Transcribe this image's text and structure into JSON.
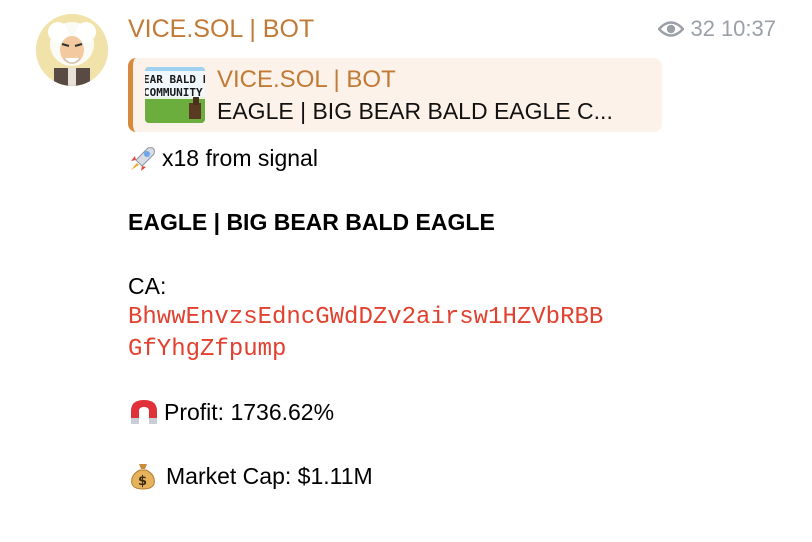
{
  "message": {
    "sender_name": "VICE.SOL | BOT",
    "views": "32",
    "time": "10:37",
    "reply": {
      "title": "VICE.SOL | BOT",
      "text": "EAGLE | BIG BEAR BALD EAGLE  C...",
      "thumb_text_line1": "EAR BALD E",
      "thumb_text_line2": "COMMUNITY"
    },
    "signal_text": "x18 from signal",
    "token_name": "EAGLE | BIG BEAR BALD EAGLE",
    "ca_label": "CA:",
    "ca_line1": "BhwwEnvzsEdncGWdDZv2airsw1HZVbRBB",
    "ca_line2": "GfYhgZfpump",
    "profit_text": "Profit: 1736.62%",
    "market_cap_text": "Market Cap: $1.11M"
  },
  "icons": {
    "views": "eye-icon",
    "signal": "rocket-emoji",
    "profit": "magnet-emoji",
    "market_cap": "money-bag-emoji"
  },
  "colors": {
    "sender": "#c07a35",
    "reply_bar": "#d88a3c",
    "reply_bg": "#fdf2e9",
    "contract": "#e2412f",
    "meta": "#9aa0a6"
  }
}
